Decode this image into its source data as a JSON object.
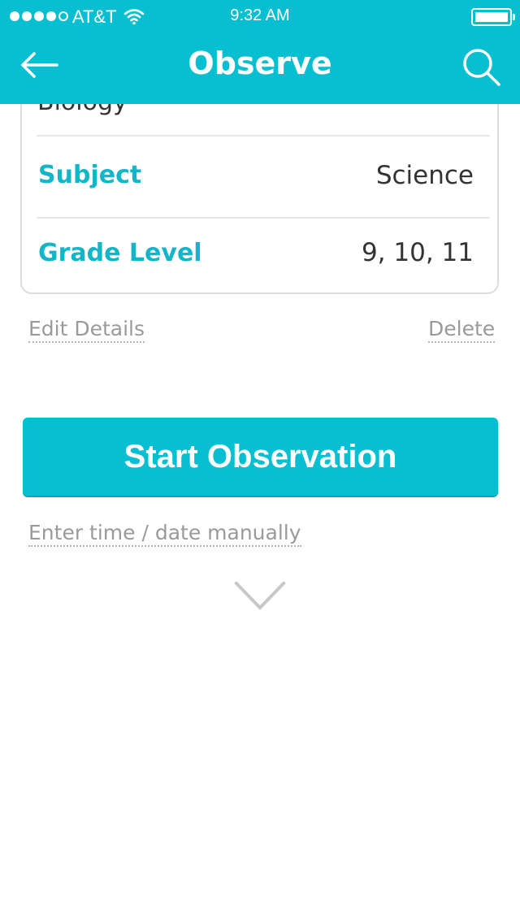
{
  "status_bar": {
    "carrier": "AT&T",
    "time": "9:32 AM",
    "signal_bars_filled": 4,
    "signal_bars_total": 5,
    "icons": [
      "signal-dots-icon",
      "wifi-icon",
      "battery-icon"
    ]
  },
  "header": {
    "title": "Observe",
    "back_icon": "arrow-left-icon",
    "search_icon": "search-icon"
  },
  "details": {
    "partial_top_text": "Biology",
    "rows": [
      {
        "label": "Subject",
        "value": "Science"
      },
      {
        "label": "Grade Level",
        "value": "9, 10, 11"
      }
    ]
  },
  "actions": {
    "edit_details": "Edit Details",
    "delete": "Delete",
    "start_observation": "Start Observation",
    "manual_entry": "Enter time / date manually",
    "expand_icon": "chevron-down-icon"
  },
  "colors": {
    "accent": "#07bfd0",
    "label_accent": "#12b6c8",
    "link_gray": "#9a9a9a"
  }
}
